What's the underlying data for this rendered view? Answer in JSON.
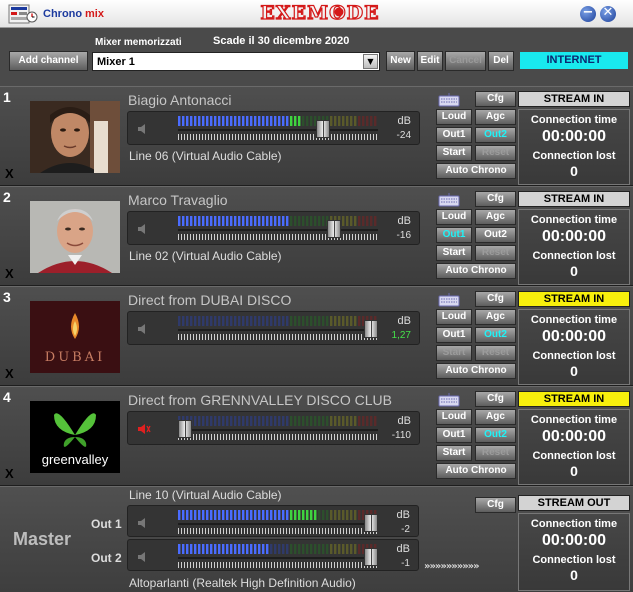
{
  "titlebar": {
    "brand_part1": "Chrono",
    "brand_part2": "mix",
    "logo_text": "EXEMODE",
    "minimize_glyph": "−",
    "close_glyph": "✕"
  },
  "toolbar": {
    "add_channel_label": "Add channel",
    "mixer_saved_label": "Mixer memorizzati",
    "expiry_text": "Scade il 30 dicembre 2020",
    "mixer_selected": "Mixer 1",
    "dropdown_arrow": "▼",
    "new_label": "New",
    "edit_label": "Edit",
    "cancel_label": "Cancel",
    "delete_label": "Del",
    "connection_status": "INTERNET"
  },
  "common": {
    "db_label": "dB",
    "cfg_label": "Cfg",
    "loud_label": "Loud",
    "agc_label": "Agc",
    "out1_label": "Out1",
    "out2_label": "Out2",
    "start_label": "Start",
    "reset_label": "Reset",
    "auto_chrono_label": "Auto Chrono",
    "connection_time_label": "Connection time",
    "connection_lost_label": "Connection lost",
    "remove_label": "X"
  },
  "channels": [
    {
      "number": "1",
      "name": "Biagio Antonacci",
      "db_value": "-24",
      "device": "Line 06 (Virtual Audio Cable)",
      "stream_label": "STREAM IN",
      "stream_live": false,
      "connection_time": "00:00:00",
      "connection_lost": "0",
      "active_output": "Out2",
      "muted": false,
      "fader_level": 0.74,
      "meter_level": 0.62
    },
    {
      "number": "2",
      "name": "Marco Travaglio",
      "db_value": "-16",
      "device": "Line 02 (Virtual Audio Cable)",
      "stream_label": "STREAM IN",
      "stream_live": false,
      "connection_time": "00:00:00",
      "connection_lost": "0",
      "active_output": "Out1",
      "muted": false,
      "fader_level": 0.8,
      "meter_level": 0.55
    },
    {
      "number": "3",
      "name": "Direct from DUBAI DISCO",
      "db_value": "1,27",
      "device": "",
      "stream_label": "STREAM IN",
      "stream_live": true,
      "connection_time": "00:00:00",
      "connection_lost": "0",
      "active_output": "Out2",
      "muted": false,
      "fader_level": 1.0,
      "meter_level": 0.0
    },
    {
      "number": "4",
      "name": "Direct from GRENNVALLEY DISCO CLUB",
      "db_value": "-110",
      "device": "",
      "stream_label": "STREAM IN",
      "stream_live": true,
      "connection_time": "00:00:00",
      "connection_lost": "0",
      "active_output": "Out2",
      "muted": true,
      "fader_level": 0.0,
      "meter_level": 0.0
    }
  ],
  "master": {
    "title": "Master",
    "input_device": "Line 10 (Virtual Audio Cable)",
    "output_device": "Altoparlanti (Realtek High Definition Audio)",
    "arrows": "»»»»»»»»»»",
    "stream_label": "STREAM OUT",
    "connection_time": "00:00:00",
    "connection_lost": "0",
    "outputs": [
      {
        "label": "Out 1",
        "db_value": "-2",
        "fader_level": 1.0,
        "meter_level": 0.7
      },
      {
        "label": "Out 2",
        "db_value": "-1",
        "fader_level": 1.0,
        "meter_level": 0.45
      }
    ]
  },
  "colors": {
    "background": "#4a4a4a",
    "internet_badge": "#19e9ee",
    "stream_live": "#f7ef0c",
    "stream_idle": "#d3d3d3",
    "active_output_text": "#1ff3f7",
    "meter_blue": "#4a6cff",
    "meter_green": "#3fd43f",
    "meter_yellow": "#f0e020",
    "meter_red": "#e23030"
  }
}
